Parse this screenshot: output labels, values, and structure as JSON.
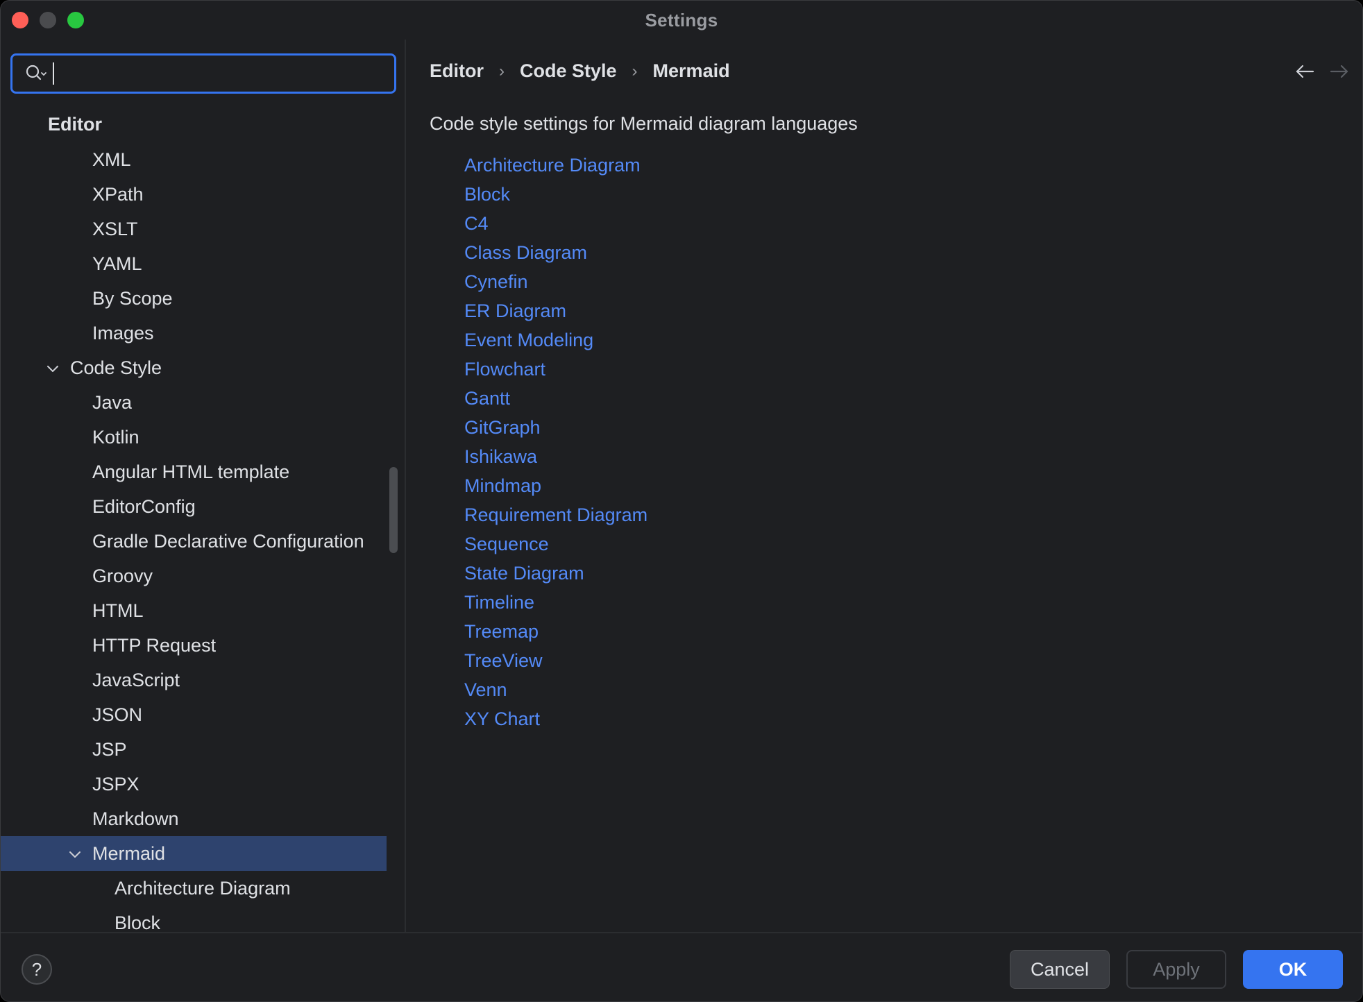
{
  "window": {
    "title": "Settings"
  },
  "search": {
    "value": "",
    "placeholder": ""
  },
  "tree": {
    "items": [
      {
        "label": "Editor",
        "level": 0,
        "header": true
      },
      {
        "label": "XML",
        "level": 2
      },
      {
        "label": "XPath",
        "level": 2
      },
      {
        "label": "XSLT",
        "level": 2
      },
      {
        "label": "YAML",
        "level": 2
      },
      {
        "label": "By Scope",
        "level": 2
      },
      {
        "label": "Images",
        "level": 2
      },
      {
        "label": "Code Style",
        "level": 1,
        "expanded": true
      },
      {
        "label": "Java",
        "level": 2
      },
      {
        "label": "Kotlin",
        "level": 2
      },
      {
        "label": "Angular HTML template",
        "level": 2
      },
      {
        "label": "EditorConfig",
        "level": 2
      },
      {
        "label": "Gradle Declarative Configuration",
        "level": 2
      },
      {
        "label": "Groovy",
        "level": 2
      },
      {
        "label": "HTML",
        "level": 2
      },
      {
        "label": "HTTP Request",
        "level": 2
      },
      {
        "label": "JavaScript",
        "level": 2
      },
      {
        "label": "JSON",
        "level": 2
      },
      {
        "label": "JSP",
        "level": 2
      },
      {
        "label": "JSPX",
        "level": 2
      },
      {
        "label": "Markdown",
        "level": 2
      },
      {
        "label": "Mermaid",
        "level": 2,
        "expanded": true,
        "selected": true
      },
      {
        "label": "Architecture Diagram",
        "level": 3
      },
      {
        "label": "Block",
        "level": 3
      }
    ]
  },
  "main": {
    "breadcrumb": [
      "Editor",
      "Code Style",
      "Mermaid"
    ],
    "description": "Code style settings for Mermaid diagram languages",
    "links": [
      "Architecture Diagram",
      "Block",
      "C4",
      "Class Diagram",
      "Cynefin",
      "ER Diagram",
      "Event Modeling",
      "Flowchart",
      "Gantt",
      "GitGraph",
      "Ishikawa",
      "Mindmap",
      "Requirement Diagram",
      "Sequence",
      "State Diagram",
      "Timeline",
      "Treemap",
      "TreeView",
      "Venn",
      "XY Chart"
    ]
  },
  "footer": {
    "help": "?",
    "cancel": "Cancel",
    "apply": "Apply",
    "ok": "OK"
  },
  "colors": {
    "accent": "#3574f0",
    "link": "#548af7",
    "selection": "#2e436e",
    "background": "#1e1f22"
  }
}
